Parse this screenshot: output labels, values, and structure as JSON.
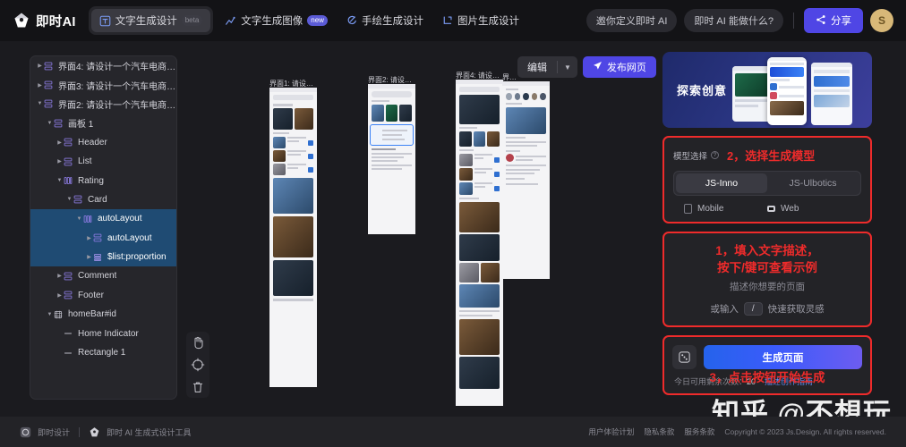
{
  "header": {
    "brand": "即时AI",
    "brand_logo_icon": "diamond-logo-icon",
    "tabs": [
      {
        "label": "文字生成设计",
        "icon": "text-to-design-icon",
        "badge": "beta",
        "active": true
      },
      {
        "label": "文字生成图像",
        "icon": "text-to-image-icon",
        "badge": "new",
        "active": false
      },
      {
        "label": "手绘生成设计",
        "icon": "sketch-to-design-icon",
        "badge": "",
        "active": false
      },
      {
        "label": "图片生成设计",
        "icon": "image-to-design-icon",
        "badge": "",
        "active": false
      }
    ],
    "invite_label": "邀你定义即时 AI",
    "help_label": "即时 AI 能做什么?",
    "share_label": "分享",
    "share_icon": "share-icon",
    "avatar_initial": "S",
    "accent_color": "#4f46e5"
  },
  "layers": {
    "items": [
      {
        "label": "界面4: 请设计一个汽车电商平...",
        "depth": 0,
        "caret": "right",
        "icon": "frame-icon",
        "selected": false
      },
      {
        "label": "界面3: 请设计一个汽车电商平...",
        "depth": 0,
        "caret": "right",
        "icon": "frame-icon",
        "selected": false
      },
      {
        "label": "界面2: 请设计一个汽车电商平...",
        "depth": 0,
        "caret": "down",
        "icon": "frame-icon",
        "selected": false
      },
      {
        "label": "画板 1",
        "depth": 1,
        "caret": "down",
        "icon": "frame-icon",
        "selected": false
      },
      {
        "label": "Header",
        "depth": 2,
        "caret": "right",
        "icon": "frame-icon",
        "selected": false
      },
      {
        "label": "List",
        "depth": 2,
        "caret": "right",
        "icon": "frame-icon",
        "selected": false
      },
      {
        "label": "Rating",
        "depth": 2,
        "caret": "down",
        "icon": "autolayout-icon",
        "selected": false
      },
      {
        "label": "Card",
        "depth": 3,
        "caret": "down",
        "icon": "frame-icon",
        "selected": false
      },
      {
        "label": "autoLayout",
        "depth": 4,
        "caret": "down",
        "icon": "autolayout-icon",
        "selected": true
      },
      {
        "label": "autoLayout",
        "depth": 5,
        "caret": "right",
        "icon": "frame-icon",
        "selected": true
      },
      {
        "label": "$list:proportion",
        "depth": 5,
        "caret": "right",
        "icon": "list-icon",
        "selected": true
      },
      {
        "label": "Comment",
        "depth": 2,
        "caret": "right",
        "icon": "frame-icon",
        "selected": false
      },
      {
        "label": "Footer",
        "depth": 2,
        "caret": "right",
        "icon": "frame-icon",
        "selected": false
      },
      {
        "label": "homeBar#id",
        "depth": 1,
        "caret": "down",
        "icon": "component-icon",
        "selected": false
      },
      {
        "label": "Home Indicator",
        "depth": 2,
        "caret": "none",
        "icon": "line-icon",
        "selected": false
      },
      {
        "label": "Rectangle 1",
        "depth": 2,
        "caret": "none",
        "icon": "line-icon",
        "selected": false
      }
    ]
  },
  "canvas": {
    "tools": [
      {
        "name": "hand-tool",
        "icon": "hand-icon"
      },
      {
        "name": "fit-tool",
        "icon": "target-icon"
      },
      {
        "name": "delete-tool",
        "icon": "trash-icon"
      }
    ],
    "frames": [
      {
        "label": "界面1: 请设…"
      },
      {
        "label": "界面2: 请设…"
      },
      {
        "label": "界面4: 请设…"
      },
      {
        "label": "界…"
      }
    ],
    "toolbar": {
      "mode_label": "编辑",
      "chevron_icon": "chevron-down-icon",
      "publish_label": "发布网页",
      "publish_icon": "send-icon"
    }
  },
  "right_panel": {
    "explore": {
      "title": "探索创意"
    },
    "model": {
      "label": "模型选择",
      "help_icon": "question-icon",
      "annotation": "2，选择生成模型",
      "options": [
        "JS-Inno",
        "JS-Ulbotics"
      ],
      "selected_option": "JS-Inno",
      "platforms": [
        {
          "label": "Mobile",
          "icon": "mobile-icon"
        },
        {
          "label": "Web",
          "icon": "web-icon"
        }
      ]
    },
    "prompt": {
      "annotation_line1": "1，填入文字描述，",
      "annotation_line2": "按下/键可查看示例",
      "placeholder": "描述你想要的页面",
      "hint_prefix": "或输入",
      "hint_key": "/",
      "hint_suffix": "快速获取灵感"
    },
    "generate": {
      "dice_icon": "dice-icon",
      "button_label": "生成页面",
      "annotation": "3，点击按钮开始生成",
      "quota_label": "今日可用剩余次数：",
      "quota_value": "20",
      "guide_label": "描述创作指南"
    },
    "annotation_color": "#ef2b2b"
  },
  "watermark": "知乎 @不想玩",
  "footer": {
    "brand1": "即时设计",
    "brand1_icon": "circle-logo-icon",
    "brand2": "即时 AI 生成式设计工具",
    "brand2_icon": "diamond-logo-icon",
    "links": [
      "用户体验计划",
      "隐私条款",
      "服务条款"
    ],
    "copyright": "Copyright © 2023 Js.Design. All rights reserved."
  }
}
